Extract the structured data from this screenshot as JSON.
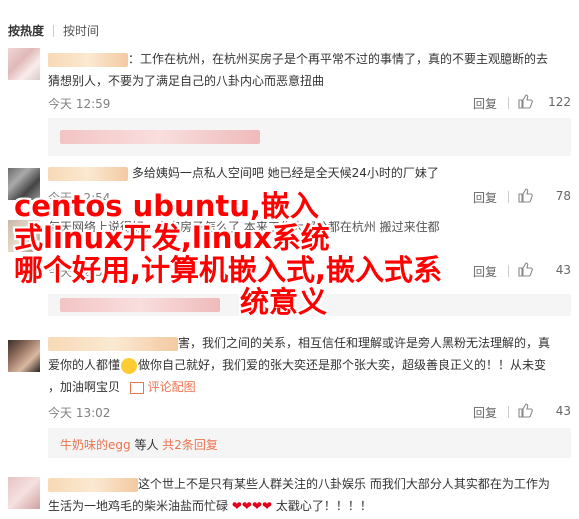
{
  "tabs": {
    "hot": "按热度",
    "time": "按时间"
  },
  "comments": [
    {
      "text_line1": "：工作在杭州，在杭州买房子是个再平常不过的事情了，真的不要主观臆断的去",
      "text_line2": "猜想别人，不要为了满足自己的八卦内心而恶意扭曲",
      "time": "今天 12:59",
      "reply": "回复",
      "likes": "122"
    },
    {
      "text": "多给姨妈一点私人空间吧 她已经是全天候24小时的厂妹了",
      "time": "今天 12:54",
      "reply": "回复",
      "likes": "78"
    },
    {
      "text_line1": "每天网络上说得好，人家房子怎么了 本来工作大部分都在杭州 搬过来住都",
      "time": "今天 12:5",
      "reply": "回复",
      "likes": "43"
    },
    {
      "text_line1": "害，我们之间的关系，相互信任和理解或许是旁人黑粉无法理解的，真",
      "text_line2": "爱你的人都懂",
      "text_line2b": "做你自己就好，我们爱的张大奕还是那个张大奕，超级善良正义的！！从未变",
      "text_line3": "，加油啊宝贝",
      "comment_image": "评论配图",
      "time": "今天 13:02",
      "reply": "回复",
      "likes": "43",
      "sub_user": "牛奶味的egg",
      "sub_tail": " 等人 ",
      "sub_link": "共2条回复"
    },
    {
      "text_line1": "这个世上不是只有某些人群关注的八卦娱乐 而我们大部分人其实都在为工作为",
      "text_line2": "生活为一地鸡毛的柴米油盐而忙碌",
      "text_line2b": "太戳心了！！！！"
    }
  ],
  "overlay": {
    "line1": "centos ubuntu,嵌入",
    "line2": "式linux开发,linux系统",
    "line3": "哪个好用,计算机嵌入式,嵌入式系",
    "line4": "统意义"
  },
  "colors": {
    "overlay": "#ff0000",
    "link": "#eb7350",
    "meta": "#808080"
  }
}
